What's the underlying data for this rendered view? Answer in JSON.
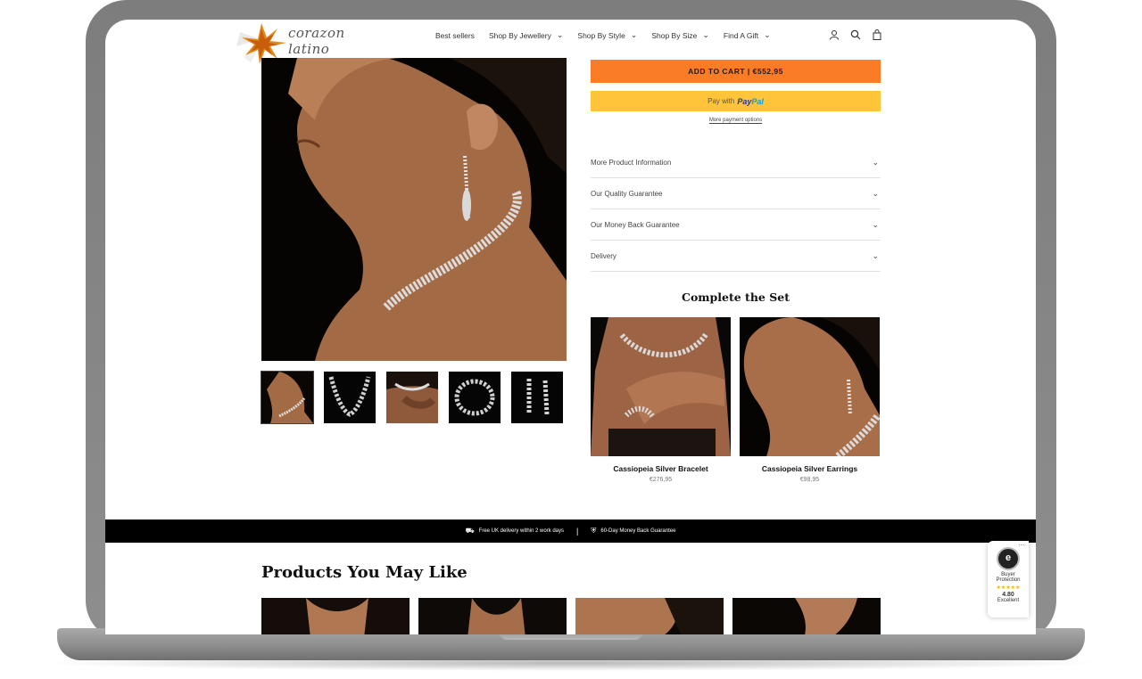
{
  "brand": {
    "name": "corazon latino"
  },
  "nav": {
    "items": [
      {
        "label": "Best sellers",
        "has_dropdown": false
      },
      {
        "label": "Shop By Jewellery",
        "has_dropdown": true
      },
      {
        "label": "Shop By Style",
        "has_dropdown": true
      },
      {
        "label": "Shop By Size",
        "has_dropdown": true
      },
      {
        "label": "Find A Gift",
        "has_dropdown": true
      }
    ],
    "icons": [
      "account-icon",
      "search-icon",
      "cart-icon"
    ]
  },
  "product": {
    "add_to_cart_label": "ADD TO CART | €552,95",
    "paypal_prefix": "Pay with",
    "paypal_brand_1": "Pay",
    "paypal_brand_2": "Pal",
    "more_payment_options": "More payment options",
    "thumbnail_count": 5
  },
  "accordion": [
    {
      "label": "More Product Information"
    },
    {
      "label": "Our Quality Guarantee"
    },
    {
      "label": "Our Money Back Guarantee"
    },
    {
      "label": "Delivery"
    }
  ],
  "complete_set": {
    "title": "Complete the Set",
    "items": [
      {
        "name": "Cassiopeia Silver Bracelet",
        "price": "€276,95"
      },
      {
        "name": "Cassiopeia Silver Earrings",
        "price": "€98,95"
      }
    ]
  },
  "info_bar": {
    "left": "Free UK delivery within 2 work days",
    "right": "60-Day Money Back Guarantee"
  },
  "recommendations": {
    "title": "Products You May Like",
    "count": 4
  },
  "trust_badge": {
    "line1": "Buyer",
    "line2": "Protection",
    "stars": "★★★★★",
    "score": "4.80",
    "rating_text": "Excellent"
  },
  "colors": {
    "accent_orange": "#fb7c26",
    "paypal_yellow": "#ffc439",
    "bar_black": "#000000"
  }
}
